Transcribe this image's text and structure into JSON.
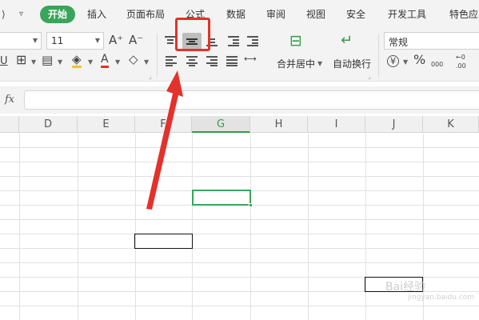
{
  "menu": {
    "items": [
      {
        "key": "start",
        "label": "开始",
        "active": true
      },
      {
        "key": "insert",
        "label": "插入"
      },
      {
        "key": "layout",
        "label": "页面布局"
      },
      {
        "key": "formula",
        "label": "公式"
      },
      {
        "key": "data",
        "label": "数据"
      },
      {
        "key": "review",
        "label": "审阅"
      },
      {
        "key": "view",
        "label": "视图"
      },
      {
        "key": "security",
        "label": "安全"
      },
      {
        "key": "devtools",
        "label": "开发工具"
      },
      {
        "key": "features",
        "label": "特色应"
      }
    ],
    "accent_color": "#39a55a"
  },
  "ribbon": {
    "font_size": "11",
    "increase_font": "A⁺",
    "decrease_font": "A⁻",
    "merge_label": "合并居中",
    "wrap_label": "自动换行",
    "number_format": "常规",
    "percent": "%",
    "thousands": "000",
    "decimal_top": "←0",
    "decimal_bottom": ".00",
    "currency": "¥",
    "highlight_color": "#e3322b"
  },
  "formula_bar": {
    "fx_label": "fx",
    "value": ""
  },
  "grid": {
    "columns": [
      "D",
      "E",
      "F",
      "G",
      "H",
      "I",
      "J",
      "K"
    ],
    "active_column": "G"
  },
  "watermark": {
    "text": "Bai经验",
    "sub": "jingyan.baidu.com"
  }
}
